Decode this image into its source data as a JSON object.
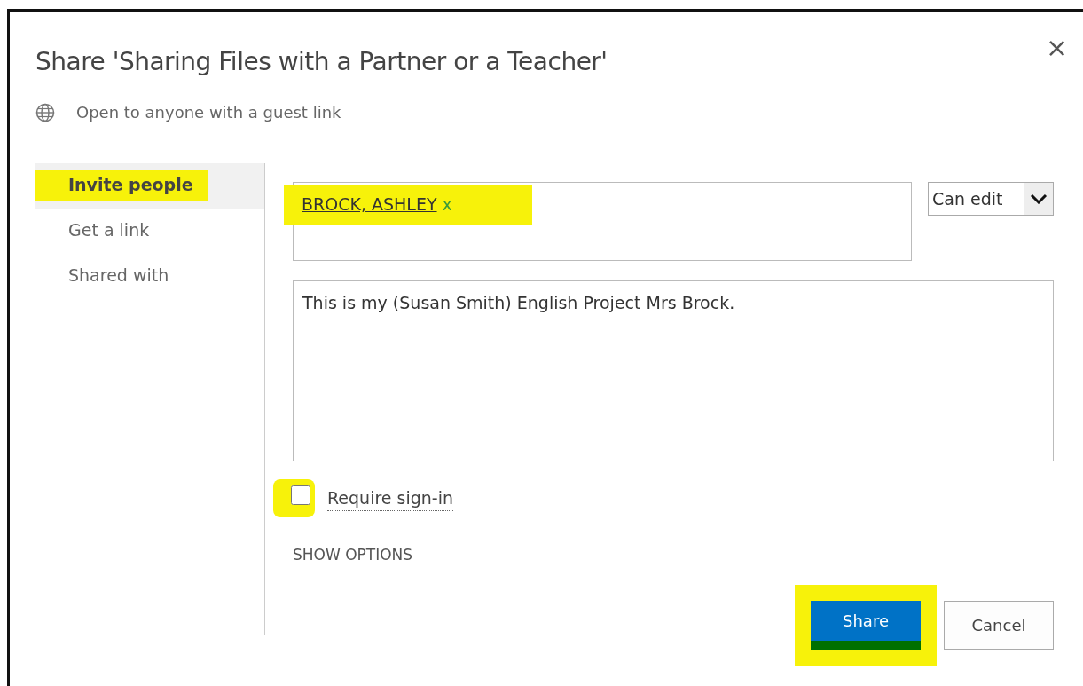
{
  "dialog": {
    "title": "Share 'Sharing Files with a Partner or a Teacher'",
    "close": "×",
    "access": "Open to anyone with a guest link"
  },
  "nav": [
    {
      "label": "Invite people",
      "selected": true,
      "highlighted": true
    },
    {
      "label": "Get a link",
      "selected": false,
      "highlighted": false
    },
    {
      "label": "Shared with",
      "selected": false,
      "highlighted": false
    }
  ],
  "recipients": [
    {
      "name": "BROCK, ASHLEY",
      "remove": "x",
      "highlighted": true
    }
  ],
  "permission": {
    "value": "Can edit"
  },
  "message": {
    "value": "This is my (Susan Smith) English Project Mrs Brock."
  },
  "require_signin": {
    "label": "Require sign-in",
    "checked": false,
    "highlighted": true
  },
  "show_options": "SHOW OPTIONS",
  "buttons": [
    {
      "label": "Share",
      "kind": "primary",
      "highlighted": true
    },
    {
      "label": "Cancel",
      "kind": "secondary",
      "highlighted": false
    }
  ]
}
